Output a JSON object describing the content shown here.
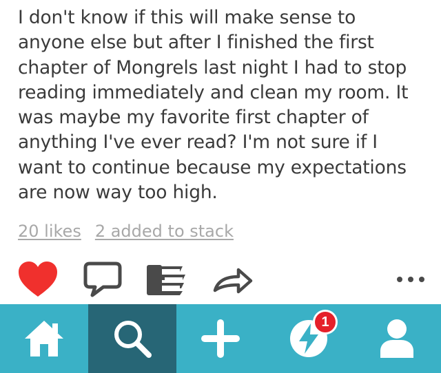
{
  "post": {
    "text": "I don't know if this will make sense to\nanyone else but after I finished the first\nchapter of Mongrels last night I had to stop\nreading immediately and clean my room. It\nwas maybe my favorite first chapter of\nanything I've ever read? I'm not sure if I\nwant to continue because my expectations\nare now way too high."
  },
  "stats": {
    "likes_label": "20 likes",
    "stack_label": "2 added to stack"
  },
  "actions": {
    "like_icon": "heart-icon",
    "comment_icon": "comment-icon",
    "stack_icon": "books-stack-icon",
    "share_icon": "share-arrow-icon",
    "more_icon": "more-dots-icon",
    "liked": true,
    "like_color": "#f0302d",
    "icon_color": "#4a4a4a"
  },
  "tabbar": {
    "background": "#3ab1c6",
    "active_background": "#276676",
    "active_tab": "search",
    "tabs": [
      {
        "id": "home",
        "icon": "home-icon"
      },
      {
        "id": "search",
        "icon": "search-icon"
      },
      {
        "id": "create",
        "icon": "plus-icon"
      },
      {
        "id": "notifications",
        "icon": "lightning-icon",
        "badge": "1"
      },
      {
        "id": "profile",
        "icon": "person-icon"
      }
    ]
  }
}
